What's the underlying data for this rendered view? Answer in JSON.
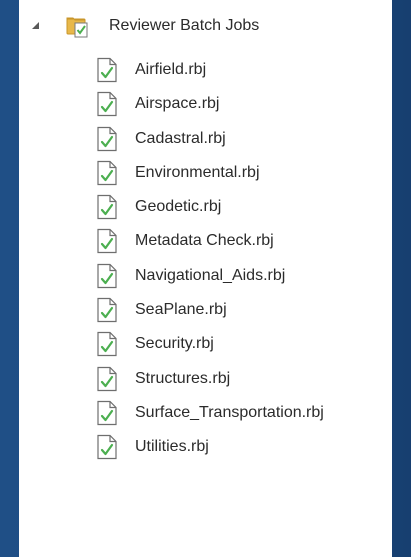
{
  "tree": {
    "root": {
      "label": "Reviewer Batch Jobs",
      "expanded": true,
      "icon": "reviewer-folder-icon"
    },
    "items": [
      {
        "label": "Airfield.rbj",
        "icon": "batch-job-file-icon"
      },
      {
        "label": "Airspace.rbj",
        "icon": "batch-job-file-icon"
      },
      {
        "label": "Cadastral.rbj",
        "icon": "batch-job-file-icon"
      },
      {
        "label": "Environmental.rbj",
        "icon": "batch-job-file-icon"
      },
      {
        "label": "Geodetic.rbj",
        "icon": "batch-job-file-icon"
      },
      {
        "label": "Metadata Check.rbj",
        "icon": "batch-job-file-icon"
      },
      {
        "label": "Navigational_Aids.rbj",
        "icon": "batch-job-file-icon"
      },
      {
        "label": "SeaPlane.rbj",
        "icon": "batch-job-file-icon"
      },
      {
        "label": "Security.rbj",
        "icon": "batch-job-file-icon"
      },
      {
        "label": "Structures.rbj",
        "icon": "batch-job-file-icon"
      },
      {
        "label": "Surface_Transportation.rbj",
        "icon": "batch-job-file-icon"
      },
      {
        "label": "Utilities.rbj",
        "icon": "batch-job-file-icon"
      }
    ]
  },
  "colors": {
    "background": "#1b4a80",
    "panel": "#ffffff",
    "text": "#2b2b2b",
    "folder": "#e8b84a",
    "checkmark": "#4caf50"
  }
}
